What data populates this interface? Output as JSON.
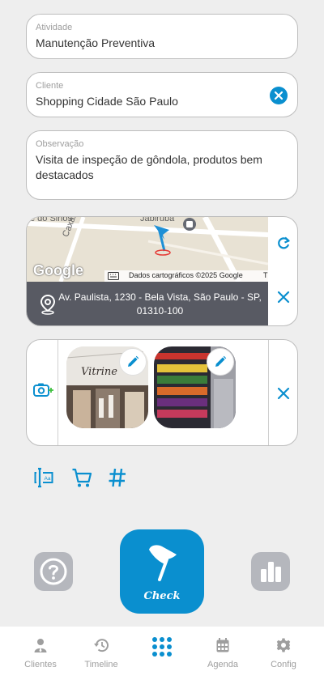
{
  "form": {
    "atividade": {
      "label": "Atividade",
      "value": "Manutenção Preventiva"
    },
    "cliente": {
      "label": "Cliente",
      "value": "Shopping Cidade São Paulo"
    },
    "observacao": {
      "label": "Observação",
      "value": "Visita de inspeção de gôndola, produtos bem destacados"
    }
  },
  "map": {
    "street_labels": [
      "e do Sinos",
      "Caxambu",
      "Jabiruba"
    ],
    "google_logo": "Google",
    "attribution": "Dados cartográficos ©2025 Google",
    "attribution_tail": "T",
    "address": "Av. Paulista, 1230 - Bela Vista, São Paulo - SP, 01310-100",
    "icons": {
      "refresh": "refresh-icon",
      "remove": "close-icon",
      "pin": "location-pin-icon",
      "marker": "flag-marker-icon"
    }
  },
  "photos": {
    "items": [
      {
        "description": "storefront photo",
        "sign_text": "Vitrine"
      },
      {
        "description": "shelf with products"
      }
    ],
    "icons": {
      "add": "add-photo-icon",
      "edit": "pencil-icon",
      "remove": "close-icon"
    }
  },
  "tools": [
    "text-field-icon",
    "cart-icon",
    "hash-icon"
  ],
  "actions": {
    "check_label": "Check",
    "help_icon": "help-icon",
    "stats_icon": "bar-chart-icon"
  },
  "nav": {
    "items": [
      {
        "label": "Clientes",
        "icon": "person-icon"
      },
      {
        "label": "Timeline",
        "icon": "history-icon"
      },
      {
        "label": "",
        "icon": "grid-icon"
      },
      {
        "label": "Agenda",
        "icon": "calendar-icon"
      },
      {
        "label": "Config",
        "icon": "gear-icon"
      }
    ]
  },
  "colors": {
    "accent": "#0a8fcf",
    "address_bar": "#585a63",
    "button_gray": "#b5b7bd",
    "background": "#eeeeee"
  }
}
